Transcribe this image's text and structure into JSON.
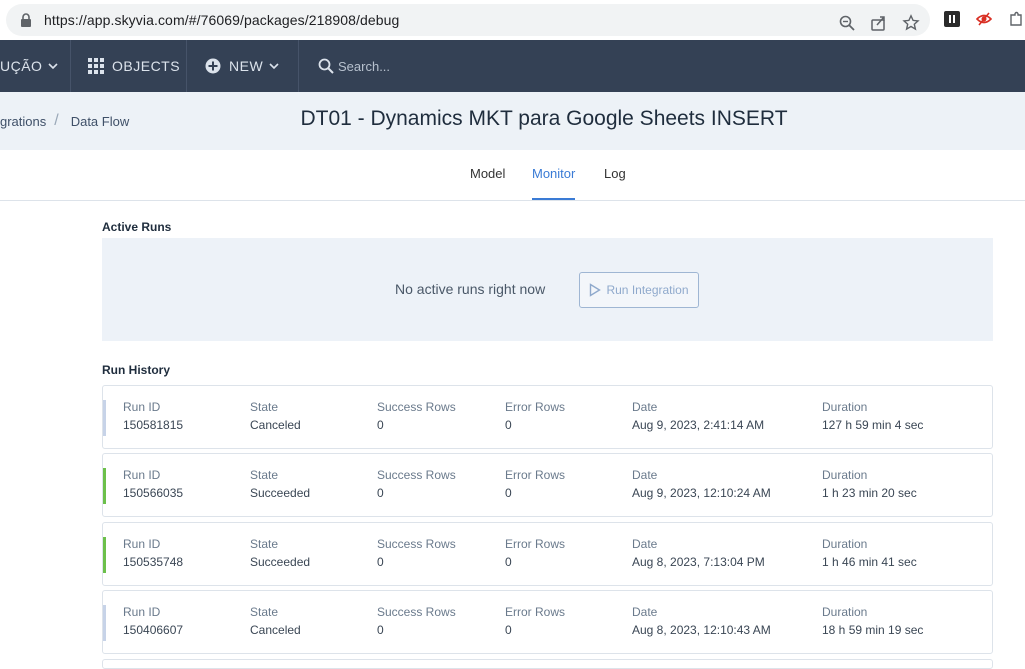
{
  "browser": {
    "url": "https://app.skyvia.com/#/76069/packages/218908/debug",
    "icons": [
      "lock-icon",
      "zoom-icon",
      "share-icon",
      "star-icon",
      "extension-pause-icon",
      "extension-eye-icon",
      "extension-puzzle-icon"
    ]
  },
  "nav": {
    "integration_label": "UÇÃO",
    "objects_label": "OBJECTS",
    "new_label": "NEW",
    "search_placeholder": "Search..."
  },
  "breadcrumb": {
    "parent": "grations",
    "current": "Data Flow"
  },
  "page": {
    "title": "DT01 - Dynamics MKT para Google Sheets INSERT"
  },
  "tabs": [
    {
      "label": "Model",
      "active": false
    },
    {
      "label": "Monitor",
      "active": true
    },
    {
      "label": "Log",
      "active": false
    }
  ],
  "active_runs": {
    "title": "Active Runs",
    "empty_text": "No active runs right now",
    "run_button": "Run Integration"
  },
  "run_history": {
    "title": "Run History",
    "headers": {
      "run_id": "Run ID",
      "state": "State",
      "success_rows": "Success Rows",
      "error_rows": "Error Rows",
      "date": "Date",
      "duration": "Duration"
    },
    "runs": [
      {
        "run_id": "150581815",
        "state": "Canceled",
        "success_rows": "0",
        "error_rows": "0",
        "date": "Aug 9, 2023, 2:41:14 AM",
        "duration": "127 h 59 min 4 sec",
        "status_color": "#c7d3e8"
      },
      {
        "run_id": "150566035",
        "state": "Succeeded",
        "success_rows": "0",
        "error_rows": "0",
        "date": "Aug 9, 2023, 12:10:24 AM",
        "duration": "1 h 23 min 20 sec",
        "status_color": "#6cc04a"
      },
      {
        "run_id": "150535748",
        "state": "Succeeded",
        "success_rows": "0",
        "error_rows": "0",
        "date": "Aug 8, 2023, 7:13:04 PM",
        "duration": "1 h 46 min 41 sec",
        "status_color": "#6cc04a"
      },
      {
        "run_id": "150406607",
        "state": "Canceled",
        "success_rows": "0",
        "error_rows": "0",
        "date": "Aug 8, 2023, 12:10:43 AM",
        "duration": "18 h 59 min 19 sec",
        "status_color": "#c7d3e8"
      }
    ]
  },
  "colors": {
    "nav_bg": "#344155",
    "accent": "#3a7bd5",
    "success": "#6cc04a",
    "canceled": "#c7d3e8"
  }
}
